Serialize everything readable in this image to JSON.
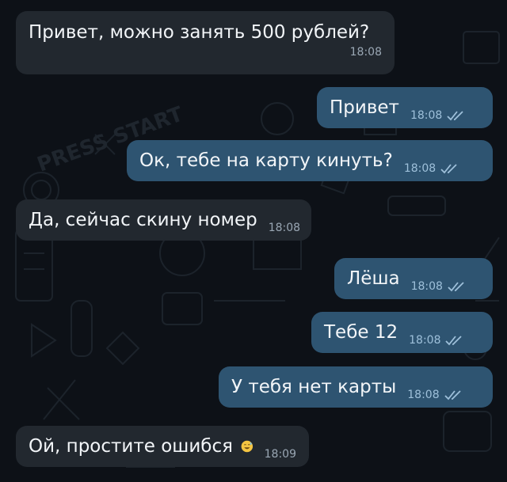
{
  "chat": {
    "messages": [
      {
        "direction": "in",
        "text": "Привет, можно занять 500 рублей?",
        "time": "18:08"
      },
      {
        "direction": "out",
        "text": "Привет",
        "time": "18:08",
        "read": true
      },
      {
        "direction": "out",
        "text": "Ок, тебе на карту кинуть?",
        "time": "18:08",
        "read": true
      },
      {
        "direction": "in",
        "text": "Да, сейчас скину номер",
        "time": "18:08"
      },
      {
        "direction": "out",
        "text": "Лёша",
        "time": "18:08",
        "read": true
      },
      {
        "direction": "out",
        "text": "Тебе 12",
        "time": "18:08",
        "read": true
      },
      {
        "direction": "out",
        "text": "У тебя нет карты",
        "time": "18:08",
        "read": true
      },
      {
        "direction": "in",
        "text": "Ой, простите ошибся",
        "time": "18:09",
        "emoji": "sweat-smile-emoji"
      }
    ]
  },
  "wallpaper": {
    "text": "PRESS START"
  },
  "colors": {
    "background": "#0d1117",
    "incoming_bubble": "#22282f",
    "outgoing_bubble": "#2e5471",
    "read_check": "#9ec0da"
  }
}
